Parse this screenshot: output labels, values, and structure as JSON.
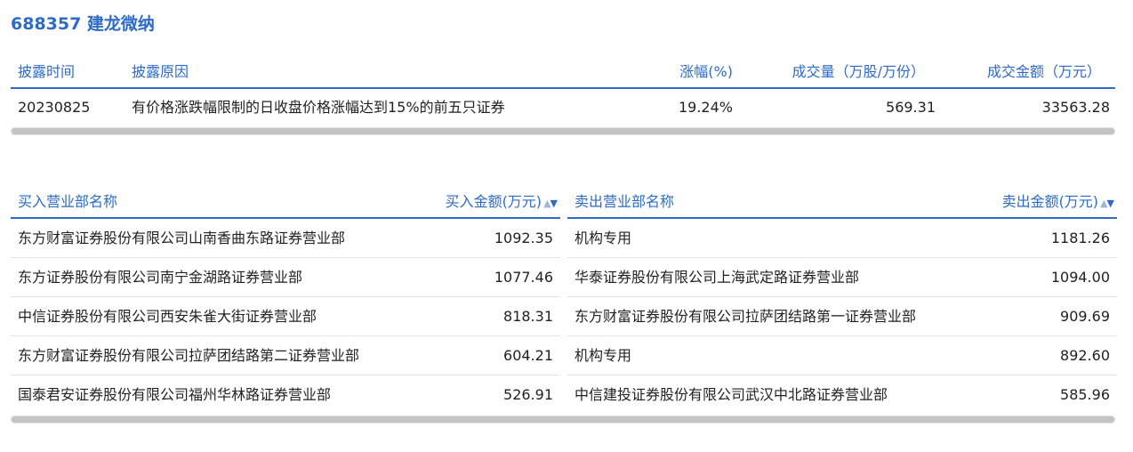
{
  "stock": {
    "title": "688357 建龙微纳"
  },
  "disclosure": {
    "headers": {
      "date": "披露时间",
      "reason": "披露原因",
      "change": "涨幅(%)",
      "volume": "成交量（万股/万份）",
      "amount": "成交金额（万元）"
    },
    "row": {
      "date": "20230825",
      "reason": "有价格涨跌幅限制的日收盘价格涨幅达到15%的前五只证券",
      "change": "19.24%",
      "volume": "569.31",
      "amount": "33563.28"
    }
  },
  "buy": {
    "headers": {
      "name": "买入营业部名称",
      "amount": "买入金额(万元)"
    },
    "rows": [
      {
        "name": "东方财富证券股份有限公司山南香曲东路证券营业部",
        "amount": "1092.35"
      },
      {
        "name": "东方证券股份有限公司南宁金湖路证券营业部",
        "amount": "1077.46"
      },
      {
        "name": "中信证券股份有限公司西安朱雀大街证券营业部",
        "amount": "818.31"
      },
      {
        "name": "东方财富证券股份有限公司拉萨团结路第二证券营业部",
        "amount": "604.21"
      },
      {
        "name": "国泰君安证券股份有限公司福州华林路证券营业部",
        "amount": "526.91"
      }
    ]
  },
  "sell": {
    "headers": {
      "name": "卖出营业部名称",
      "amount": "卖出金额(万元)"
    },
    "rows": [
      {
        "name": "机构专用",
        "amount": "1181.26"
      },
      {
        "name": "华泰证券股份有限公司上海武定路证券营业部",
        "amount": "1094.00"
      },
      {
        "name": "东方财富证券股份有限公司拉萨团结路第一证券营业部",
        "amount": "909.69"
      },
      {
        "name": "机构专用",
        "amount": "892.60"
      },
      {
        "name": "中信建投证券股份有限公司武汉中北路证券营业部",
        "amount": "585.96"
      }
    ]
  },
  "icons": {
    "sort": "sort-arrows-icon"
  },
  "colors": {
    "accent": "#2e6bc6",
    "text": "#222222",
    "divider": "#e3e3e3"
  }
}
